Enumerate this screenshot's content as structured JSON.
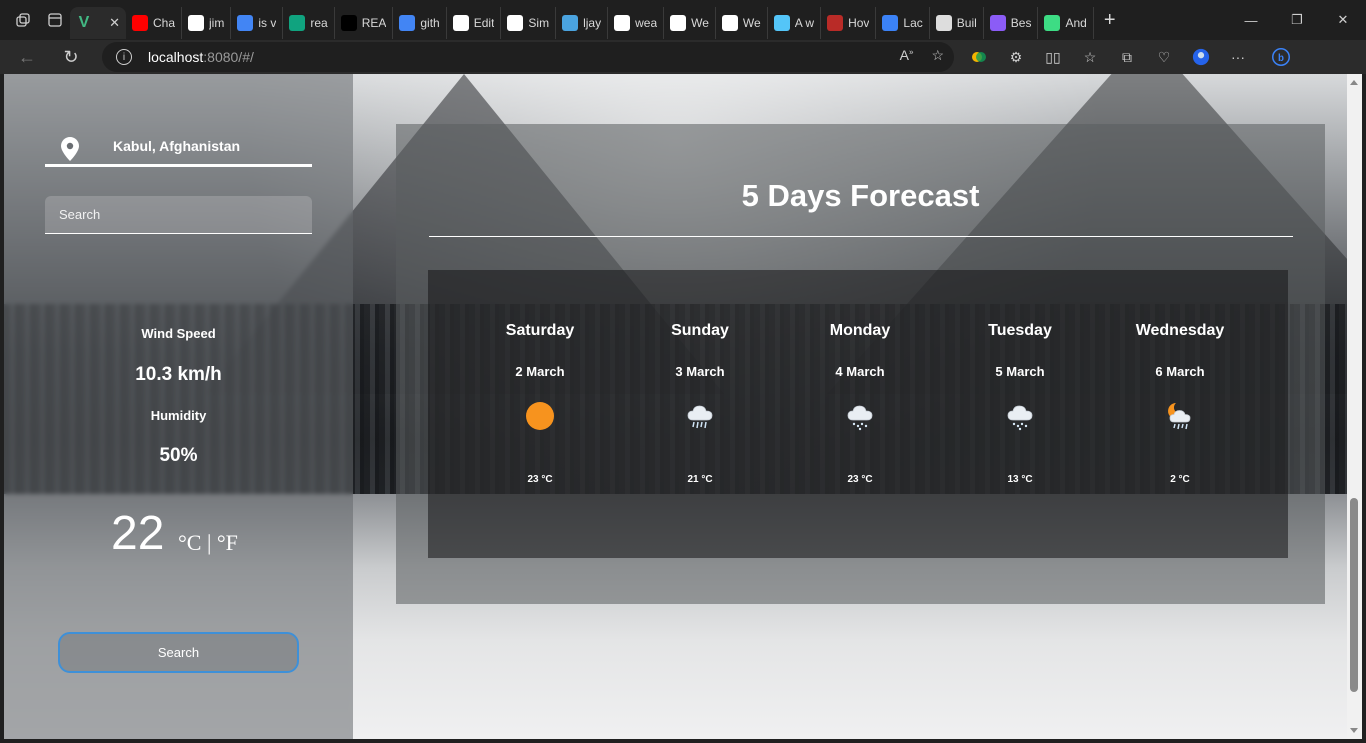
{
  "browser": {
    "tabs": [
      {
        "title": "Cha",
        "icon": "youtube-icon",
        "color": "#ff0000"
      },
      {
        "title": "jim",
        "icon": "github-icon",
        "color": "#ffffff"
      },
      {
        "title": "is v",
        "icon": "google-icon",
        "color": "#4285f4"
      },
      {
        "title": "rea",
        "icon": "openai-icon",
        "color": "#10a37f"
      },
      {
        "title": "REA",
        "icon": "notion-icon",
        "color": "#000000"
      },
      {
        "title": "gith",
        "icon": "google-icon",
        "color": "#4285f4"
      },
      {
        "title": "Edit",
        "icon": "github-icon",
        "color": "#ffffff"
      },
      {
        "title": "Sim",
        "icon": "github-icon",
        "color": "#ffffff"
      },
      {
        "title": "ljay",
        "icon": "dot-icon",
        "color": "#4aa3df"
      },
      {
        "title": "wea",
        "icon": "github-icon",
        "color": "#ffffff"
      },
      {
        "title": "We",
        "icon": "github-icon",
        "color": "#ffffff"
      },
      {
        "title": "We",
        "icon": "github-icon",
        "color": "#ffffff"
      },
      {
        "title": "A w",
        "icon": "flutter-icon",
        "color": "#54c5f8"
      },
      {
        "title": "Hov",
        "icon": "quora-icon",
        "color": "#b92b27"
      },
      {
        "title": "Lac",
        "icon": "drop-icon",
        "color": "#3b82f6"
      },
      {
        "title": "Buil",
        "icon": "hex-icon",
        "color": "#dddddd"
      },
      {
        "title": "Bes",
        "icon": "rock-icon",
        "color": "#8b5cf6"
      },
      {
        "title": "And",
        "icon": "android-icon",
        "color": "#3ddc84"
      }
    ],
    "active_tab_icon": "vue-icon",
    "url_host": "localhost",
    "url_path": ":8080/#/"
  },
  "sidebar": {
    "location": "Kabul, Afghanistan",
    "search_placeholder": "Search",
    "wind_label": "Wind Speed",
    "wind_value": "10.3 km/h",
    "humidity_label": "Humidity",
    "humidity_value": "50%",
    "temperature": "22",
    "unit_toggle": "°C | °F",
    "search_button": "Search"
  },
  "forecast": {
    "title": "5 Days Forecast",
    "days": [
      {
        "name": "Saturday",
        "date": "2 March",
        "icon": "sun-icon",
        "temp": "23 °C"
      },
      {
        "name": "Sunday",
        "date": "3 March",
        "icon": "rain-cloud-icon",
        "temp": "21 °C"
      },
      {
        "name": "Monday",
        "date": "4 March",
        "icon": "snow-cloud-icon",
        "temp": "23 °C"
      },
      {
        "name": "Tuesday",
        "date": "5 March",
        "icon": "snow-cloud-icon",
        "temp": "13 °C"
      },
      {
        "name": "Wednesday",
        "date": "6 March",
        "icon": "night-rain-icon",
        "temp": "2 °C"
      }
    ]
  }
}
